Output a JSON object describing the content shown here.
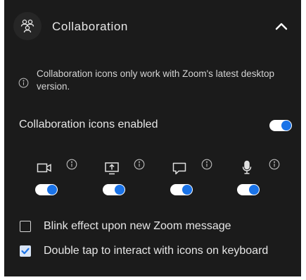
{
  "header": {
    "title": "Collaboration",
    "icon": "users-icon",
    "collapse_icon": "chevron-up-icon"
  },
  "info_note": {
    "icon": "info-icon",
    "text": "Collaboration icons only work with Zoom's latest desktop version."
  },
  "collab_toggle": {
    "label": "Collaboration icons enabled",
    "enabled": true
  },
  "features": [
    {
      "icon": "video-camera-icon",
      "enabled": true
    },
    {
      "icon": "share-screen-icon",
      "enabled": true
    },
    {
      "icon": "chat-icon",
      "enabled": true
    },
    {
      "icon": "microphone-icon",
      "enabled": true
    }
  ],
  "options": [
    {
      "label": "Blink effect upon new Zoom message",
      "checked": false
    },
    {
      "label": "Double tap to interact with icons on keyboard",
      "checked": true
    }
  ],
  "colors": {
    "panel_bg": "#1b1b1b",
    "accent": "#1a73e8",
    "text": "#e6e6e6"
  }
}
